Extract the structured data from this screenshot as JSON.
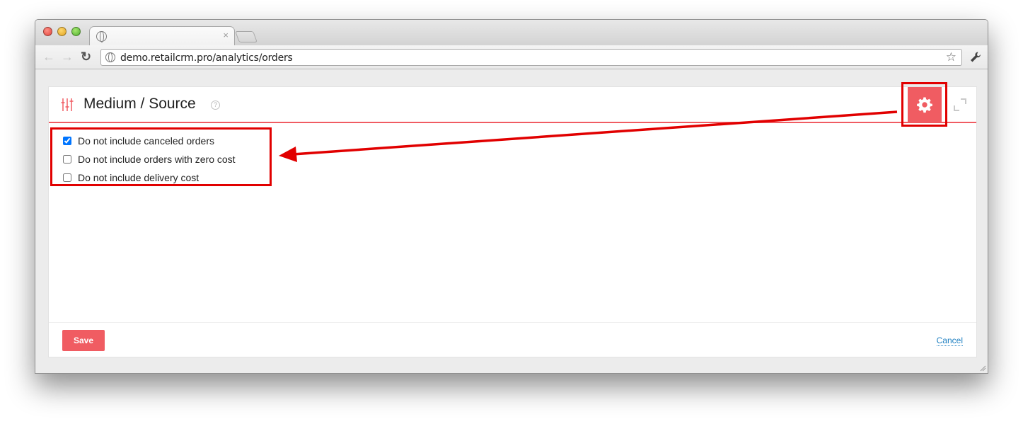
{
  "browser": {
    "tab": {
      "close_glyph": "×",
      "favicon": "globe-icon"
    },
    "address_bar": {
      "url": "demo.retailcrm.pro/analytics/orders"
    },
    "icons": [
      "back-arrow-icon",
      "forward-arrow-icon",
      "reload-icon",
      "star-icon",
      "wrench-icon"
    ]
  },
  "panel": {
    "title": "Medium / Source",
    "help_glyph": "?",
    "accent_color": "#f05c62",
    "options": [
      {
        "label": "Do not include canceled orders",
        "checked": true
      },
      {
        "label": "Do not include orders with zero cost",
        "checked": false
      },
      {
        "label": "Do not include delivery cost",
        "checked": false
      }
    ],
    "save_label": "Save",
    "cancel_label": "Cancel"
  },
  "annotations": {
    "color": "#e10000",
    "items": [
      "options-highlight-box",
      "gear-highlight-box",
      "pointer-arrow"
    ]
  }
}
